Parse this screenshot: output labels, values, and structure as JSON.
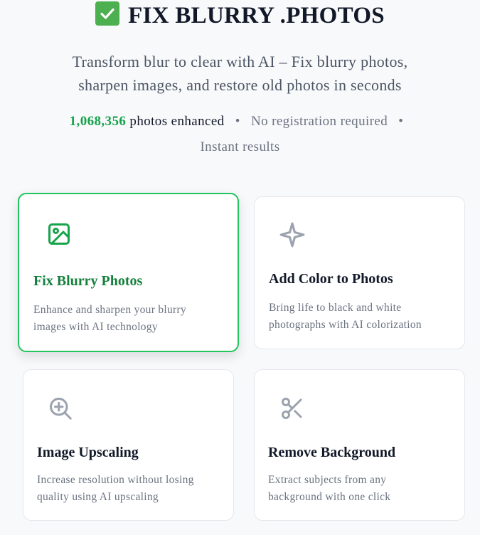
{
  "header": {
    "title": "FIX BLURRY .PHOTOS",
    "title_icon": "check-mark-icon",
    "subtitle_line1": "Transform blur to clear with AI – Fix blurry photos,",
    "subtitle_line2": "sharpen images, and restore old photos in seconds",
    "stats": {
      "count": "1,068,356",
      "count_label": "photos enhanced",
      "separator": "•",
      "no_registration": "No registration required",
      "instant": "Instant results"
    }
  },
  "colors": {
    "accent": "#16a34a",
    "check_bg": "#4caf50"
  },
  "tools": [
    {
      "icon": "image-icon",
      "title": "Fix Blurry Photos",
      "desc_line1": "Enhance and sharpen your blurry",
      "desc_line2": "images with AI technology",
      "selected": true
    },
    {
      "icon": "sparkle-icon",
      "title": "Add Color to Photos",
      "desc_line1": "Bring life to black and white",
      "desc_line2": "photographs with AI colorization",
      "selected": false
    },
    {
      "icon": "zoom-in-icon",
      "title": "Image Upscaling",
      "desc_line1": "Increase resolution without losing",
      "desc_line2": "quality using AI upscaling",
      "selected": false
    },
    {
      "icon": "scissors-icon",
      "title": "Remove Background",
      "desc_line1": "Extract subjects from any",
      "desc_line2": "background with one click",
      "selected": false
    }
  ]
}
